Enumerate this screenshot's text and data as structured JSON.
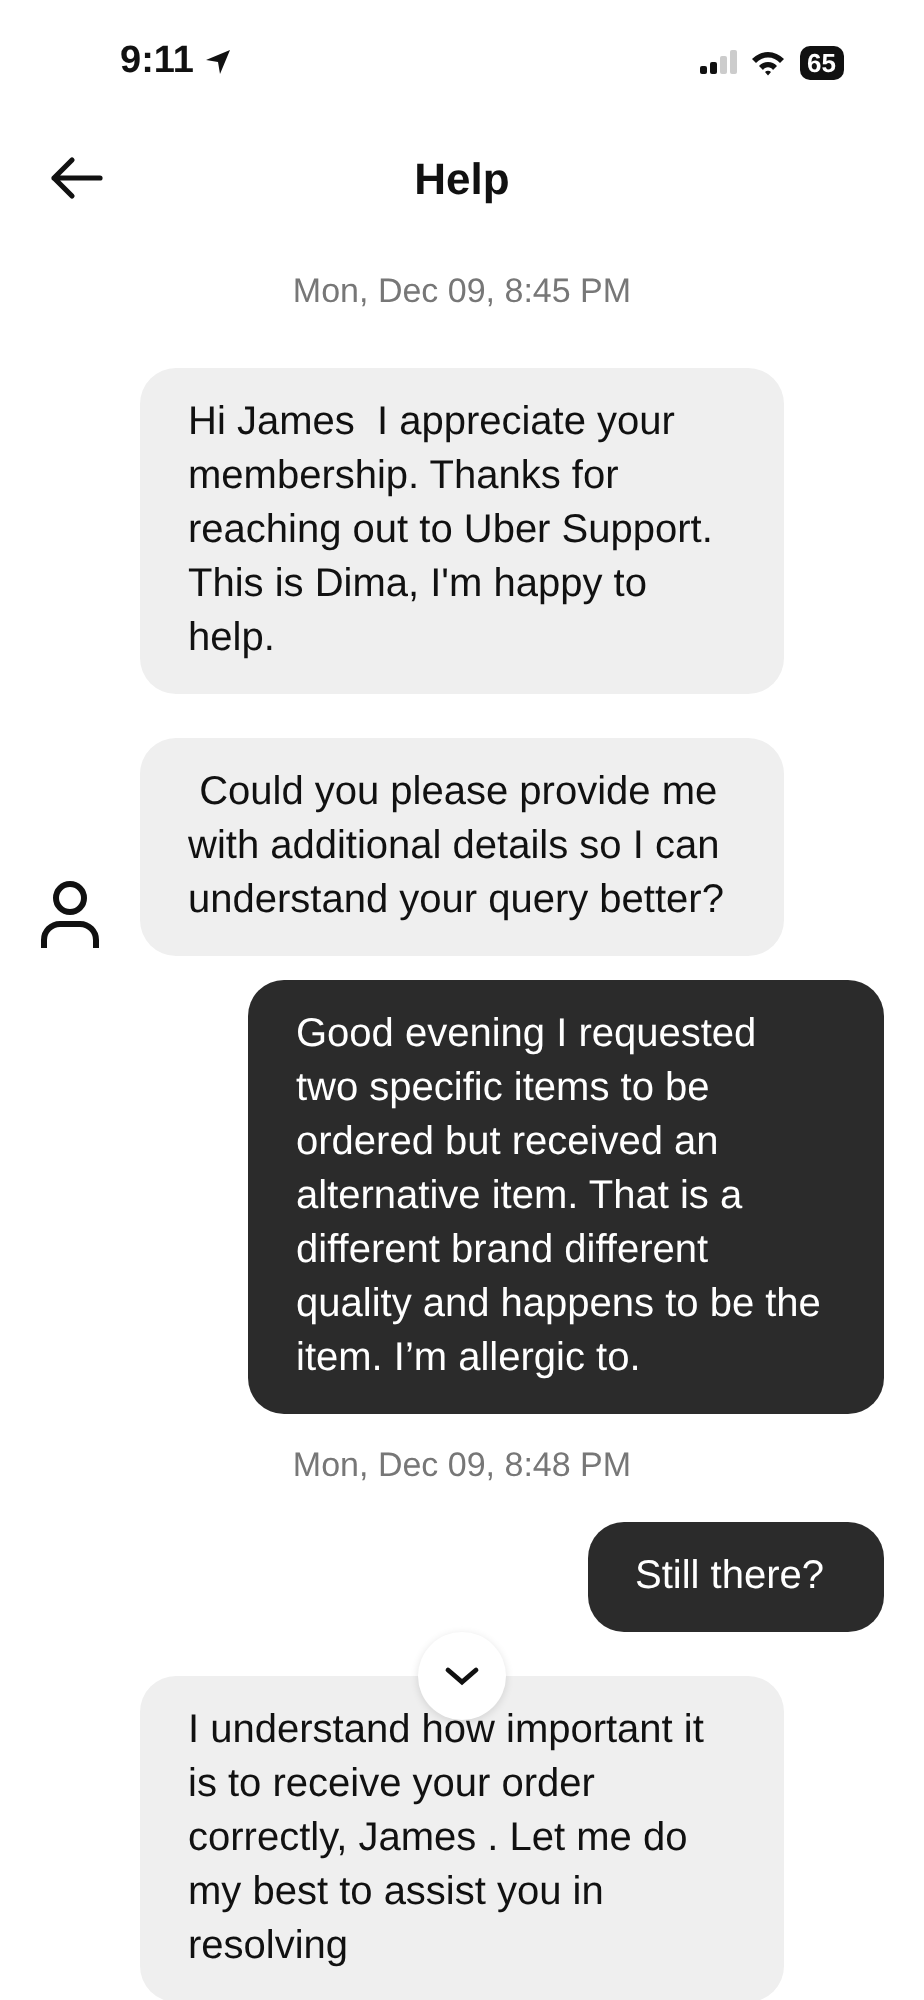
{
  "status_bar": {
    "time": "9:11",
    "battery": "65"
  },
  "header": {
    "title": "Help"
  },
  "messages": [
    {
      "kind": "timestamp",
      "text": "Mon, Dec 09, 8:45 PM"
    },
    {
      "kind": "agent",
      "text": "Hi James  I appreciate your membership. Thanks for reaching out to Uber Support. This is Dima, I'm happy to help.",
      "avatar": false
    },
    {
      "kind": "agent",
      "text": " Could you please provide me with additional details so I can understand your query better?",
      "avatar": true
    },
    {
      "kind": "user",
      "text": "Good evening I requested two specific items to be ordered but received an alternative item. That is a different brand different quality and happens to be the item. I’m allergic to."
    },
    {
      "kind": "timestamp",
      "text": "Mon, Dec 09, 8:48 PM"
    },
    {
      "kind": "user",
      "text": "Still there?"
    },
    {
      "kind": "agent",
      "text": "I understand how important it is to receive your order correctly, James . Let me do my best to assist you in resolving",
      "avatar": false
    }
  ]
}
